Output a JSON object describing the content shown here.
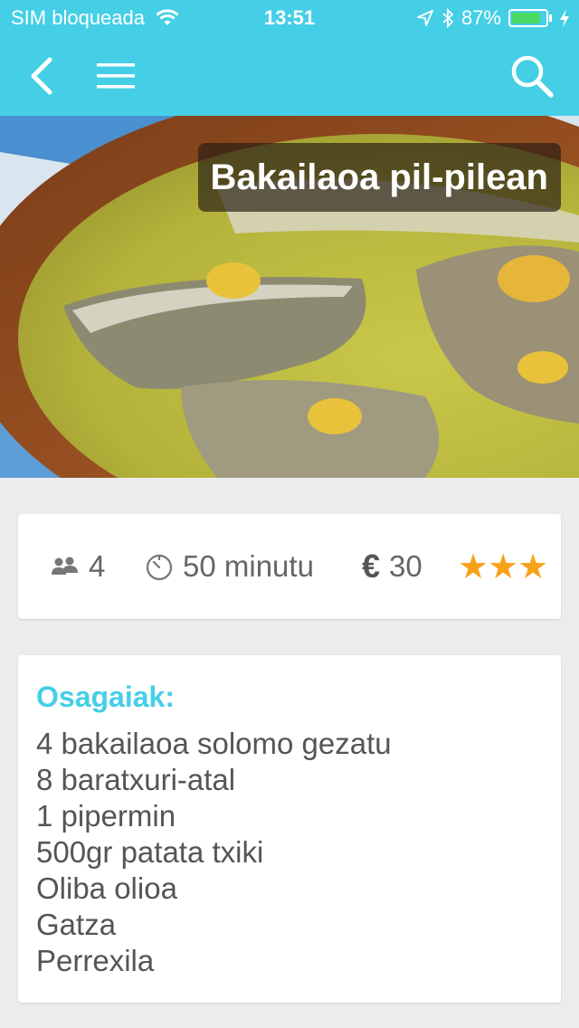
{
  "status_bar": {
    "carrier": "SIM bloqueada",
    "time": "13:51",
    "battery": "87%",
    "battery_level": 0.87,
    "icons": [
      "wifi-icon",
      "location-icon",
      "bluetooth-icon",
      "battery-icon",
      "charging-icon"
    ]
  },
  "nav": {
    "icons": [
      "back-arrow-icon",
      "hamburger-menu-icon",
      "search-icon"
    ],
    "color": "#45cfe6"
  },
  "recipe": {
    "title": "Bakailaoa pil-pilean",
    "servings": "4",
    "time": "50 minutu",
    "currency": "€",
    "price": "30",
    "rating": "★★★",
    "rating_value": 3,
    "rating_color": "#f7a21b"
  },
  "ingredients": {
    "heading": "Osagaiak:",
    "items": [
      "4 bakailaoa solomo gezatu",
      "8 baratxuri-atal",
      "1 pipermin",
      "500gr patata txiki",
      "Oliba olioa",
      "Gatza",
      "Perrexila"
    ]
  }
}
